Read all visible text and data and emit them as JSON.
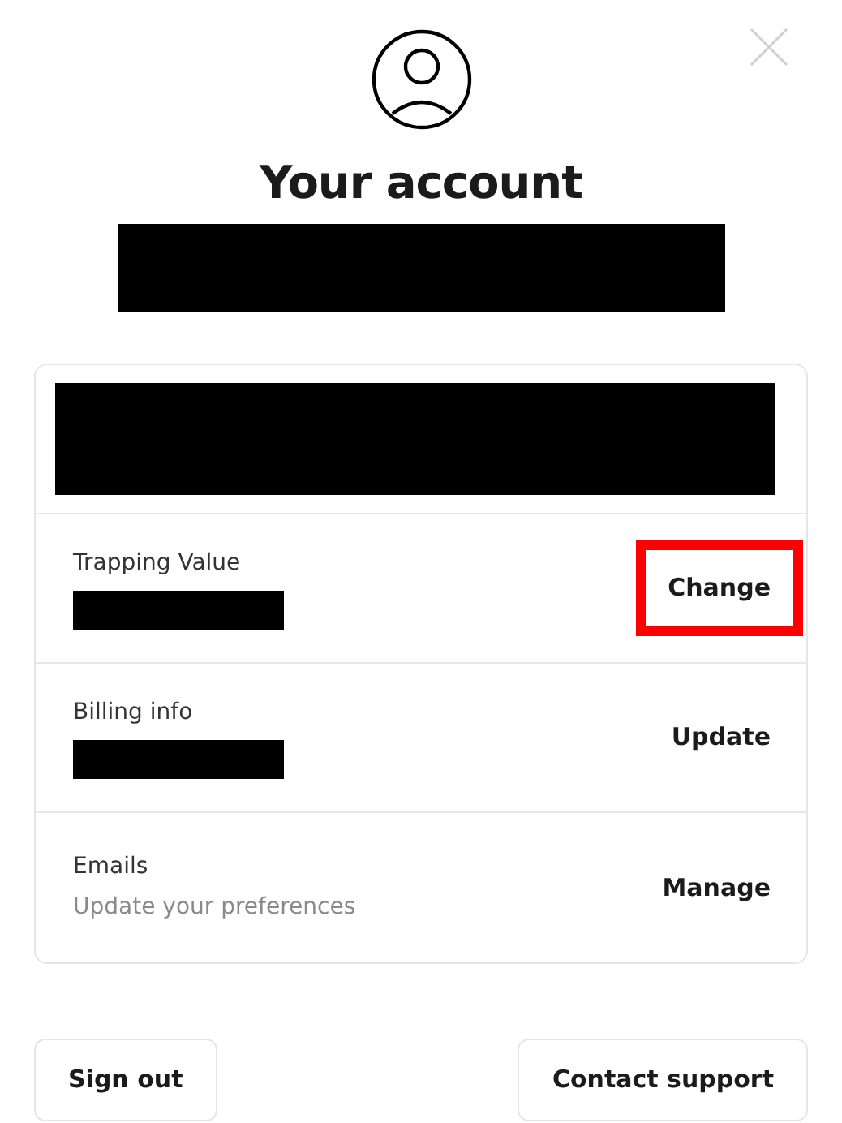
{
  "header": {
    "title": "Your account",
    "subtitle_redacted": true
  },
  "rows": [
    {
      "kind": "redacted"
    },
    {
      "kind": "setting",
      "label": "Trapping Value",
      "detail_redacted": true,
      "action": "Change",
      "highlighted": true
    },
    {
      "kind": "setting",
      "label": "Billing info",
      "detail_redacted": true,
      "action": "Update",
      "highlighted": false
    },
    {
      "kind": "setting",
      "label": "Emails",
      "detail": "Update your preferences",
      "action": "Manage",
      "highlighted": false
    }
  ],
  "buttons": [
    {
      "label": "Sign out"
    },
    {
      "label": "Contact support"
    }
  ]
}
